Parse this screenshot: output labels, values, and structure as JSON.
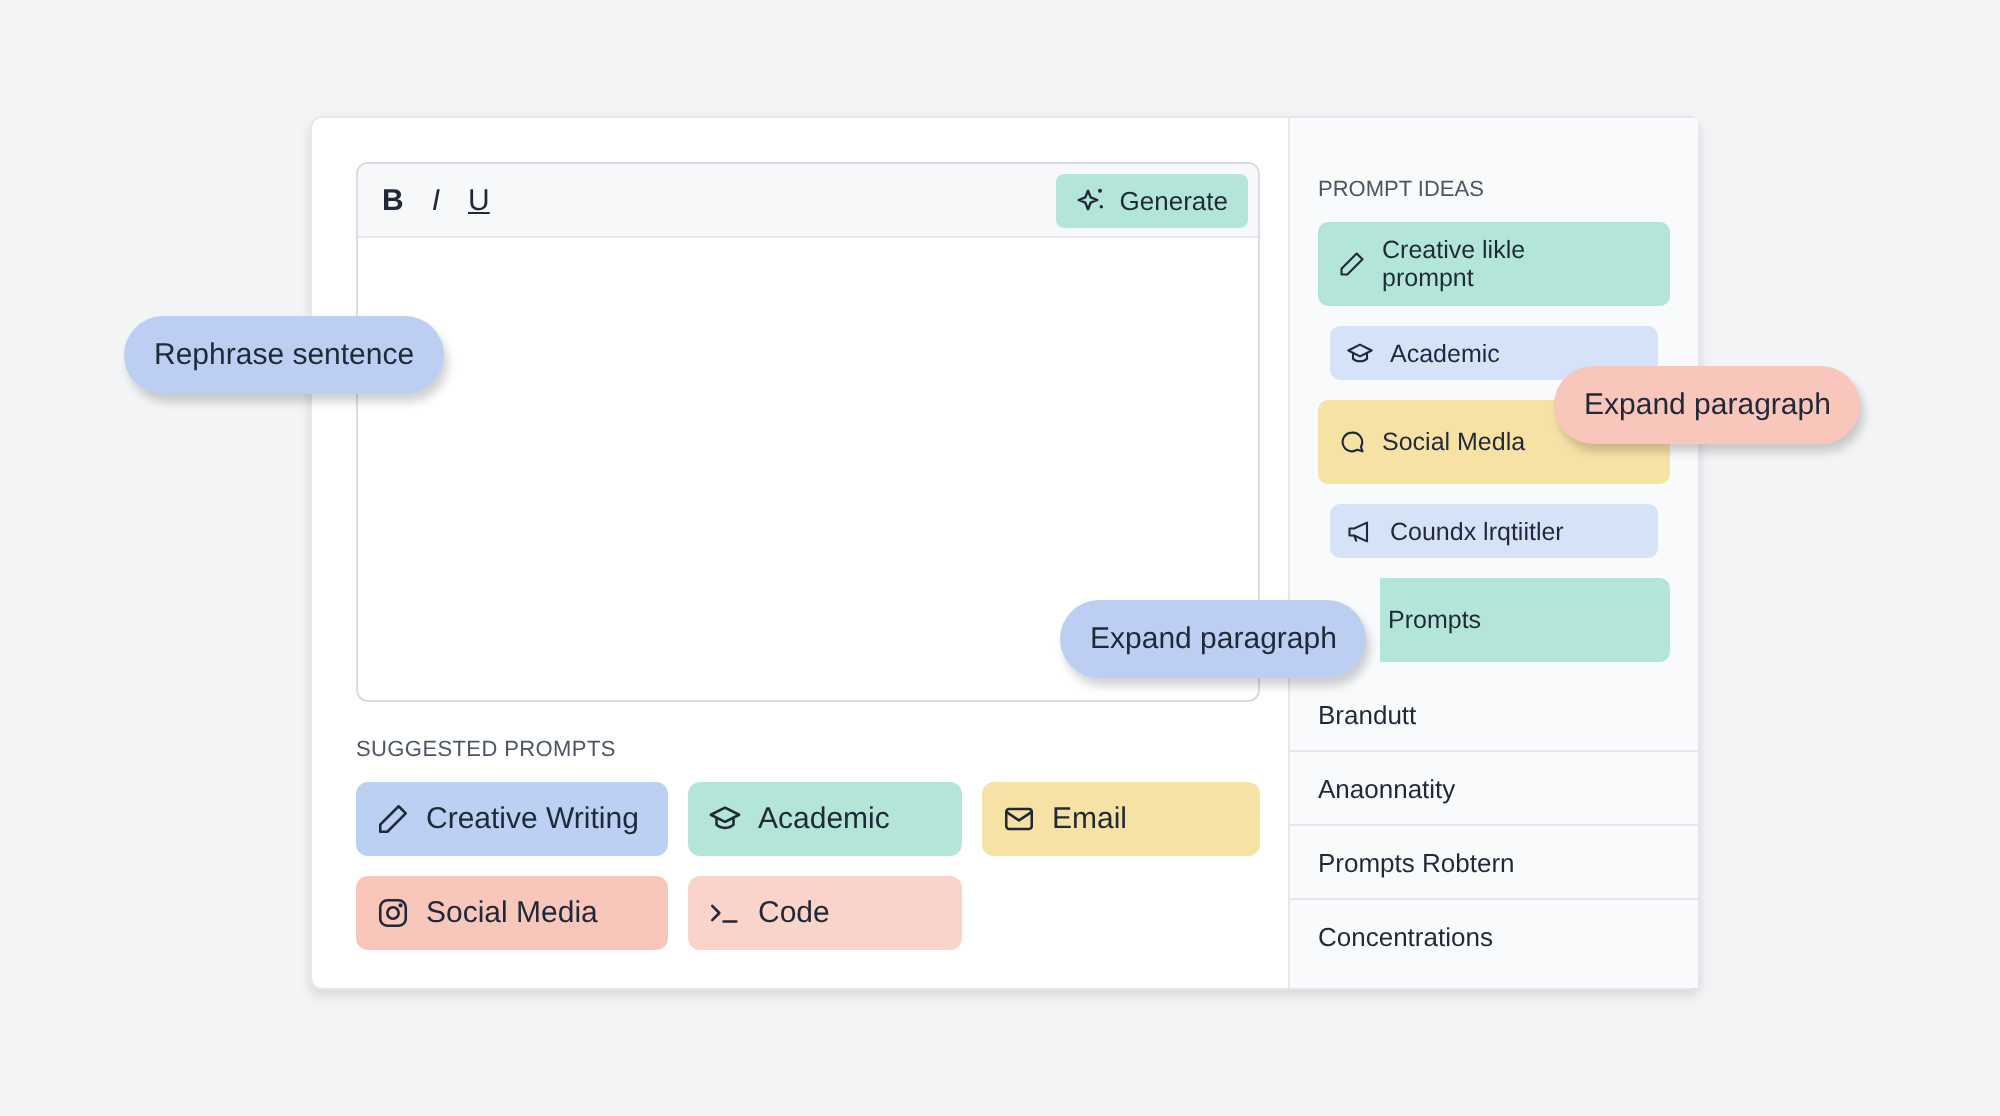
{
  "editor": {
    "toolbar": [
      "B",
      "I",
      "U"
    ],
    "generate_button": "Generate"
  },
  "suggested_prompts": {
    "title": "SUGGESTED PROMPTS",
    "items": [
      {
        "label": "Creative Writing",
        "color": "#bcd0f3"
      },
      {
        "label": "Academic",
        "color": "#b3e6d8"
      },
      {
        "label": "Email",
        "color": "#f7e2a6"
      },
      {
        "label": "Social Media",
        "color": "#f8c6bb"
      },
      {
        "label": "Code",
        "color": "#fad3ca"
      }
    ]
  },
  "prompt_ideas": {
    "title": "PROMPT IDEAS",
    "items": [
      {
        "label": "Creative likle prompnt",
        "kind": "large",
        "color": "#b3e6d8"
      },
      {
        "label": "Academic",
        "kind": "small",
        "color": "#d5e2f7"
      },
      {
        "label": "Social Medla",
        "kind": "large",
        "color": "#f7e2a6"
      },
      {
        "label": "Coundx lrqtiitler",
        "kind": "small",
        "color": "#d5e2f7"
      },
      {
        "label": "Prompts",
        "kind": "large",
        "color": "#b3e6d8"
      }
    ],
    "list": [
      "Brandutt",
      "Anaonnatity",
      "Prompts Robtern",
      "Concentrations"
    ]
  },
  "floating_chips": [
    {
      "label": "Rephrase sentence",
      "color": "#bccff2"
    },
    {
      "label": "Expand paragraph",
      "color": "#f8c6bb"
    },
    {
      "label": "Expand paragraph",
      "color": "#bccff2"
    }
  ]
}
